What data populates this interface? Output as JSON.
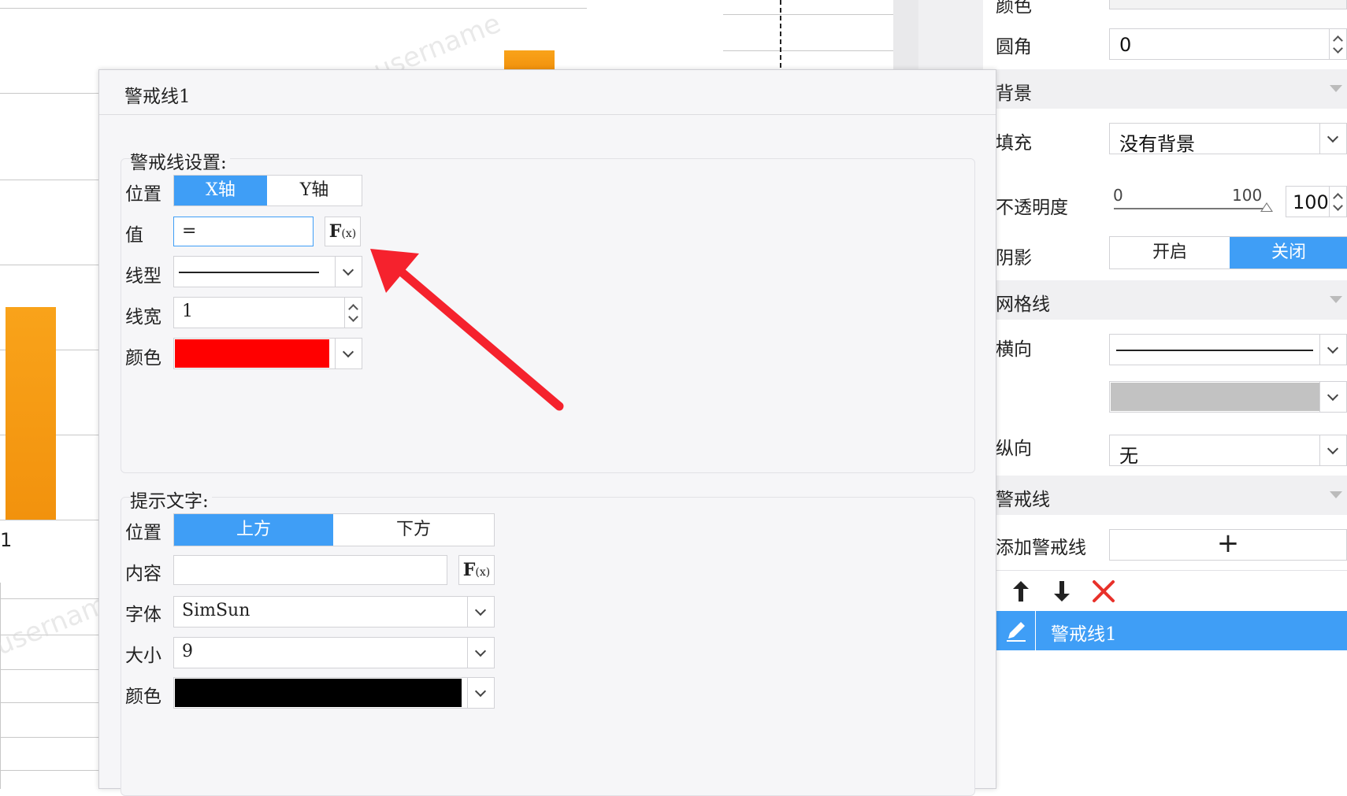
{
  "canvas": {
    "watermark": "username"
  },
  "panel": {
    "top_cut_label": "颜色",
    "radius": {
      "label": "圆角",
      "value": "0"
    },
    "background_section": "背景",
    "fill": {
      "label": "填充",
      "value": "没有背景"
    },
    "opacity": {
      "label": "不透明度",
      "min": "0",
      "max": "100",
      "value": "100"
    },
    "shadow": {
      "label": "阴影",
      "on_label": "开启",
      "off_label": "关闭",
      "selected": "关闭"
    },
    "gridlines_section": "网格线",
    "horizontal": {
      "label": "横向"
    },
    "vertical": {
      "label": "纵向",
      "value": "无"
    },
    "warning_section": "警戒线",
    "add_warning": {
      "label": "添加警戒线",
      "button": "+"
    },
    "warning_list": [
      {
        "name": "警戒线1",
        "selected": true
      }
    ],
    "colors": {
      "accent": "#3f9ef6",
      "delete": "#e8312a",
      "grid_color_swatch": "#c2c2c2"
    }
  },
  "dialog": {
    "title": "警戒线1",
    "line_settings": {
      "group_title": "警戒线设置:",
      "position_label": "位置",
      "position_options": [
        "X轴",
        "Y轴"
      ],
      "position_selected": "X轴",
      "value_label": "值",
      "value": "=",
      "fx_label": "F",
      "fx_sub": "(x)",
      "line_type_label": "线型",
      "line_width_label": "线宽",
      "line_width": "1",
      "color_label": "颜色",
      "color": "#ff0000"
    },
    "hint_text": {
      "group_title": "提示文字:",
      "position_label": "位置",
      "position_options": [
        "上方",
        "下方"
      ],
      "position_selected": "上方",
      "content_label": "内容",
      "content": "",
      "font_label": "字体",
      "font": "SimSun",
      "size_label": "大小",
      "size": "9",
      "color_label": "颜色",
      "color": "#000000"
    }
  },
  "annotation": {
    "arrow_color": "#f5222d"
  }
}
